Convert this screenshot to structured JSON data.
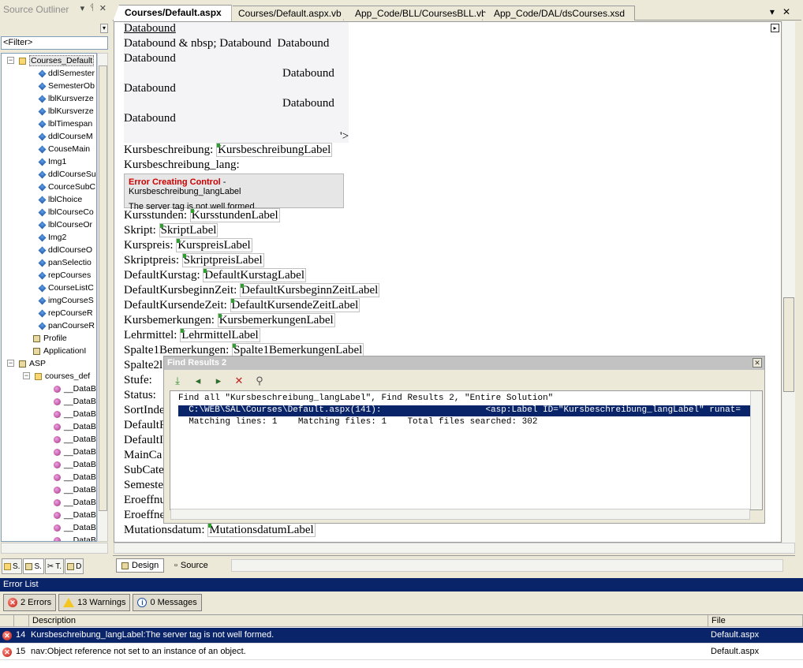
{
  "outliner": {
    "title": "Source Outliner",
    "title_buttons": [
      "▾",
      "ᛩ",
      "✕"
    ],
    "filter": "<Filter>",
    "root": "Courses_Default",
    "controls": [
      "ddlSemester",
      "SemesterOb",
      "lblKursverze",
      "lblKursverze",
      "lblTimespan",
      "ddlCourseM",
      "CouseMain",
      "Img1",
      "ddlCourseSu",
      "CourceSubC",
      "lblChoice",
      "lblCourseCo",
      "lblCourseOr",
      "Img2",
      "ddlCourseO",
      "panSelectio",
      "repCourses",
      "CourseListC",
      "imgCourseS",
      "repCourseR",
      "panCourseR"
    ],
    "extras": [
      "Profile",
      "ApplicationI"
    ],
    "asp_label": "ASP",
    "asp_child": "courses_def",
    "data_items": [
      "__DataB",
      "__DataB",
      "__DataB",
      "__DataB",
      "__DataB",
      "__DataB",
      "__DataB",
      "__DataB",
      "__DataB",
      "__DataB",
      "__DataB",
      "__DataB",
      "__DataB"
    ],
    "tabs": [
      "S.",
      "S.",
      "T.",
      "D"
    ]
  },
  "editor": {
    "tabs": [
      "Courses/Default.aspx",
      "Courses/Default.aspx.vb",
      "App_Code/BLL/CoursesBLL.vb",
      "App_Code/DAL/dsCourses.xsd"
    ],
    "tab_controls": [
      "▾",
      "✕"
    ],
    "databound": {
      "l1": "Databound",
      "l2": "Databound & nbsp; Databound  Databound",
      "l3": "Databound",
      "l4": "Databound",
      "l5": "Databound",
      "l6": "Databound",
      "l7": "Databound",
      "tail": "'>"
    },
    "rows": [
      {
        "label": "Kursbeschreibung:",
        "ctrl": "KursbeschreibungLabel"
      },
      {
        "label": "Kursbeschreibung_lang:",
        "ctrl": ""
      }
    ],
    "error_control": {
      "title": "Error Creating Control",
      "title_suffix": " - Kursbeschreibung_langLabel",
      "message": "The server tag is not well formed."
    },
    "rows2": [
      {
        "label": "Kursstunden:",
        "ctrl": "KursstundenLabel"
      },
      {
        "label": "Skript:",
        "ctrl": "SkriptLabel"
      },
      {
        "label": "Kurspreis:",
        "ctrl": "KurspreisLabel"
      },
      {
        "label": "Skriptpreis:",
        "ctrl": "SkriptpreisLabel"
      },
      {
        "label": "DefaultKurstag:",
        "ctrl": "DefaultKurstagLabel"
      },
      {
        "label": "DefaultKursbeginnZeit:",
        "ctrl": "DefaultKursbeginnZeitLabel"
      },
      {
        "label": "DefaultKursendeZeit:",
        "ctrl": "DefaultKursendeZeitLabel"
      },
      {
        "label": "Kursbemerkungen:",
        "ctrl": "KursbemerkungenLabel"
      },
      {
        "label": "Lehrmittel:",
        "ctrl": "LehrmittelLabel"
      },
      {
        "label": "Spalte1Bemerkungen:",
        "ctrl": "Spalte1BemerkungenLabel"
      }
    ],
    "partial_rows": [
      "Spalte2l",
      "Stufe:",
      "Status:",
      "SortInde",
      "DefaultF",
      "DefaultI",
      "MainCa",
      "SubCate",
      "Semeste",
      "Eroeffnu",
      "Eroeffne"
    ],
    "last_row": {
      "label": "Mutationsdatum:",
      "ctrl": "MutationsdatumLabel"
    },
    "view_tabs": [
      "Design",
      "Source"
    ]
  },
  "find": {
    "title": "Find Results 2",
    "close": "✕",
    "line1": "Find all \"Kursbeschreibung_langLabel\", Find Results 2, \"Entire Solution\"",
    "line2": "  C:\\WEB\\SAL\\Courses\\Default.aspx(141):                    <asp:Label ID=\"Kursbeschreibung_langLabel\" runat=",
    "line3": "  Matching lines: 1    Matching files: 1    Total files searched: 302"
  },
  "errors": {
    "title": "Error List",
    "filters": [
      "2 Errors",
      "13 Warnings",
      "0 Messages"
    ],
    "columns": [
      "",
      "",
      "Description",
      "File"
    ],
    "rows": [
      {
        "num": "14",
        "desc": "Kursbeschreibung_langLabel:The server tag is not well formed.",
        "file": "Default.aspx"
      },
      {
        "num": "15",
        "desc": "nav:Object reference not set to an instance of an object.",
        "file": "Default.aspx"
      }
    ]
  }
}
